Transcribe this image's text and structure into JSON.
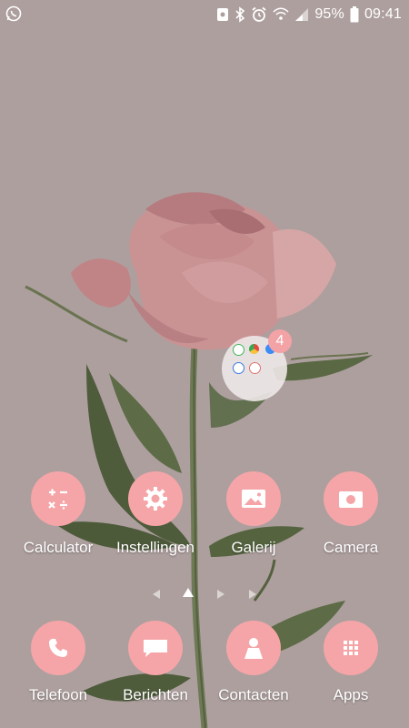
{
  "status_bar": {
    "battery_percent": "95%",
    "time": "09:41",
    "icons": [
      "whatsapp-icon",
      "photo-icon",
      "bluetooth-icon",
      "alarm-icon",
      "wifi-icon",
      "signal-icon",
      "battery-icon"
    ]
  },
  "folder": {
    "badge": "4",
    "apps": [
      "whatsapp-icon",
      "chrome-icon",
      "messenger-icon",
      "safari-icon",
      "app-icon"
    ]
  },
  "home_apps": [
    {
      "label": "Calculator",
      "icon": "calculator-icon"
    },
    {
      "label": "Instellingen",
      "icon": "settings-gear-icon"
    },
    {
      "label": "Galerij",
      "icon": "gallery-icon"
    },
    {
      "label": "Camera",
      "icon": "camera-icon"
    }
  ],
  "dock_apps": [
    {
      "label": "Telefoon",
      "icon": "phone-icon"
    },
    {
      "label": "Berichten",
      "icon": "messages-icon"
    },
    {
      "label": "Contacten",
      "icon": "contacts-icon"
    },
    {
      "label": "Apps",
      "icon": "apps-grid-icon"
    }
  ],
  "page_indicator": {
    "pages": 4,
    "current": 2
  },
  "colors": {
    "background": "#ad9f9e",
    "icon_circle": "#f5a5a7",
    "badge": "#f3a3a6"
  }
}
